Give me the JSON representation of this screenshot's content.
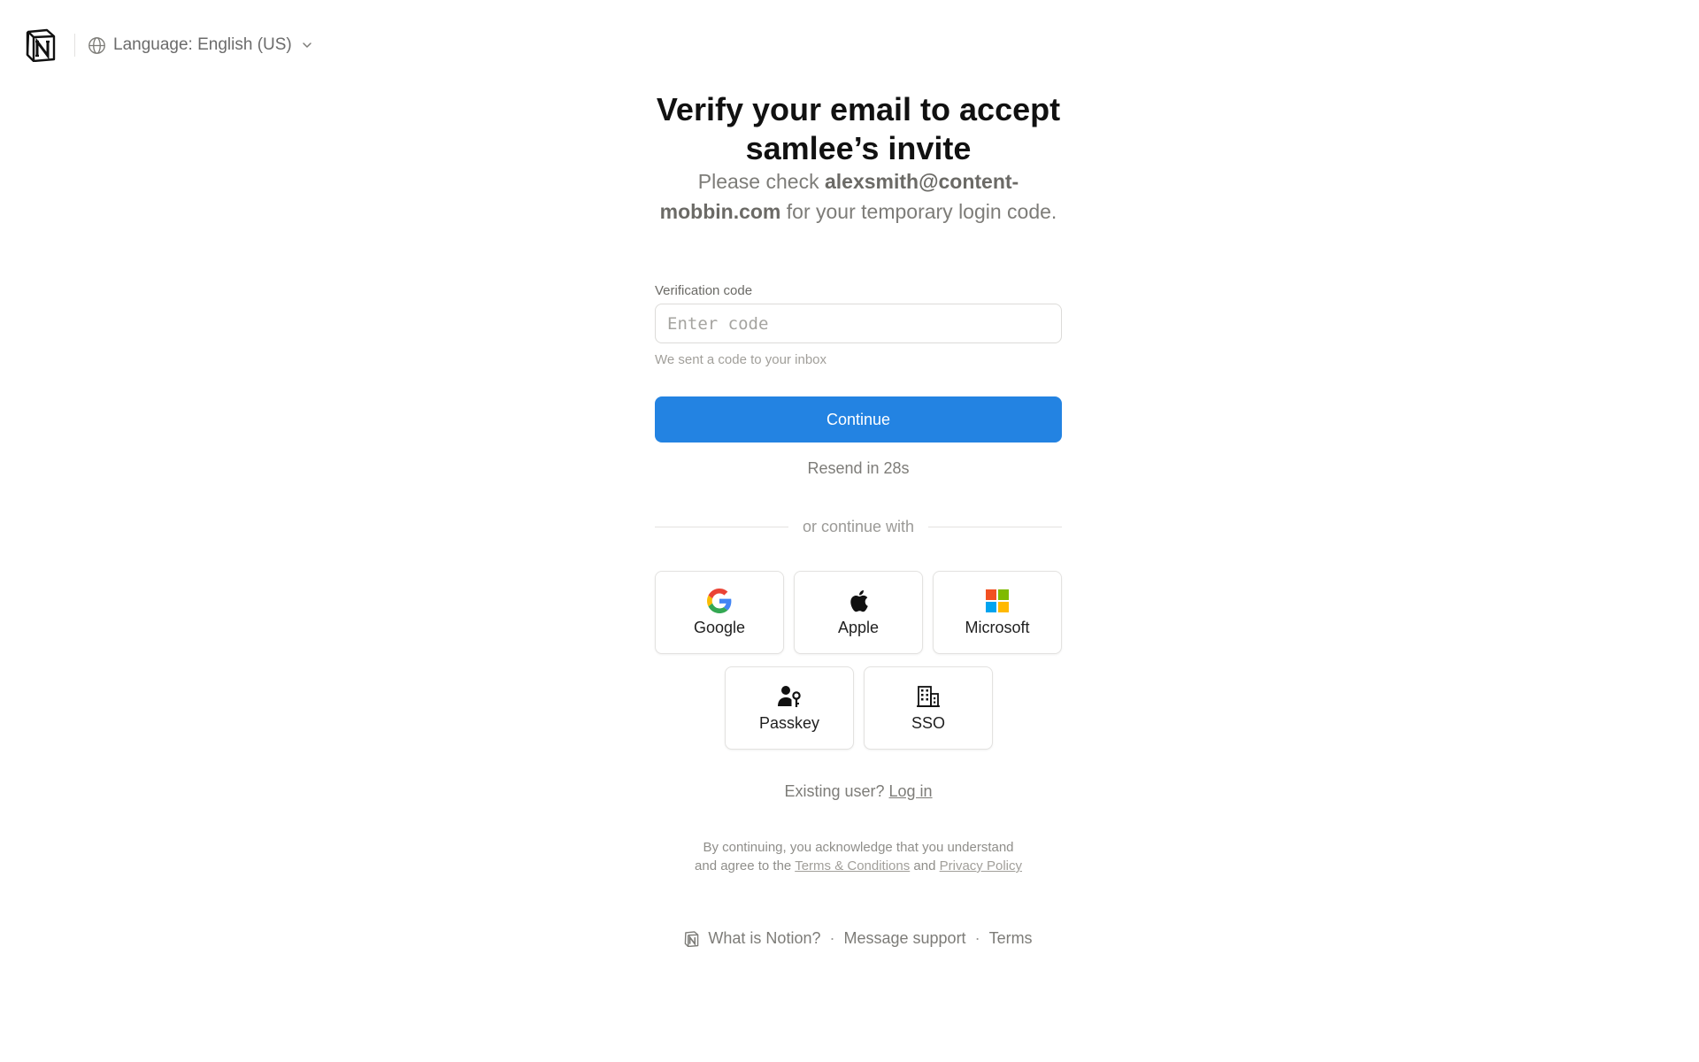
{
  "header": {
    "language_label": "Language: English (US)"
  },
  "main": {
    "title": "Verify your email to accept samlee’s invite",
    "subtitle_prefix": "Please check ",
    "subtitle_email": "alexsmith@content-mobbin.com",
    "subtitle_suffix": " for your temporary login code.",
    "field_label": "Verification code",
    "field_placeholder": "Enter code",
    "field_value": "",
    "hint": "We sent a code to your inbox",
    "continue_label": "Continue",
    "resend_text": "Resend in 28s",
    "or_text": "or continue with"
  },
  "providers": {
    "google": "Google",
    "apple": "Apple",
    "microsoft": "Microsoft",
    "passkey": "Passkey",
    "sso": "SSO"
  },
  "existing": {
    "prefix": "Existing user?",
    "link": "Log in"
  },
  "legal": {
    "line1": "By continuing, you acknowledge that you understand",
    "line2_prefix": "and agree to the",
    "terms_link": "Terms & Conditions",
    "and": "and",
    "privacy_link": "Privacy Policy"
  },
  "footer": {
    "what_is": "What is Notion?",
    "support": "Message support",
    "terms": "Terms",
    "separator": "·"
  },
  "colors": {
    "accent": "#2383e2",
    "google_blue": "#4285F4",
    "google_red": "#EA4335",
    "google_yellow": "#FBBC05",
    "google_green": "#34A853",
    "ms_red": "#F25022",
    "ms_green": "#7FBA00",
    "ms_blue": "#00A4EF",
    "ms_yellow": "#FFB900"
  }
}
